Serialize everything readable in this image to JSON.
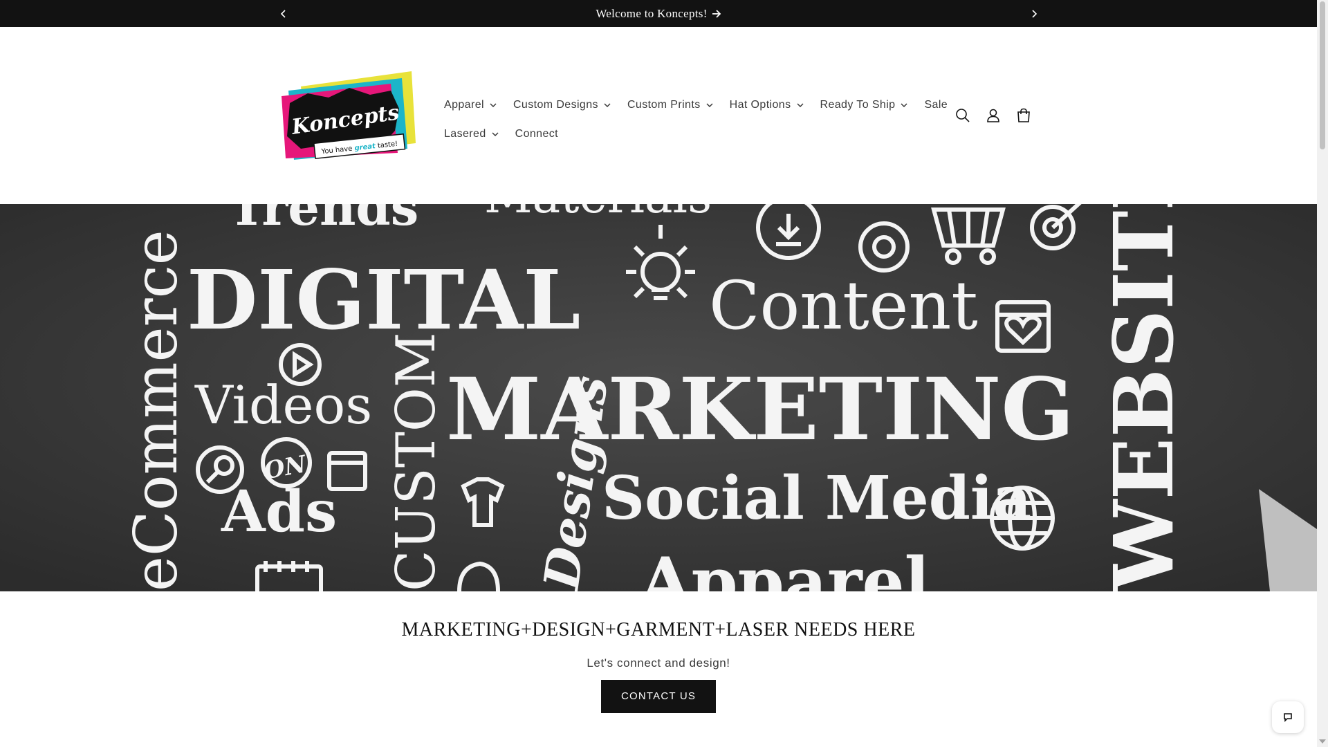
{
  "announcement": {
    "text": "Welcome to Koncepts!"
  },
  "logo": {
    "brand": "Koncepts",
    "tagline_pre": "You have ",
    "tagline_em": "great",
    "tagline_post": " taste!"
  },
  "nav": {
    "items": [
      {
        "label": "Apparel",
        "dropdown": true
      },
      {
        "label": "Custom Designs",
        "dropdown": true
      },
      {
        "label": "Custom Prints",
        "dropdown": true
      },
      {
        "label": "Hat Options",
        "dropdown": true
      },
      {
        "label": "Ready To Ship",
        "dropdown": true
      },
      {
        "label": "Sale",
        "dropdown": false
      },
      {
        "label": "Lasered",
        "dropdown": true
      },
      {
        "label": "Connect",
        "dropdown": false
      }
    ]
  },
  "header_icons": [
    "search-icon",
    "account-icon",
    "cart-icon"
  ],
  "hero": {
    "words": {
      "trends": "Trends",
      "materials": "Materials",
      "digital": "DIGITAL",
      "content": "Content",
      "videos": "Videos",
      "marketing": "MARKETING",
      "ads": "Ads",
      "social_media": "Social Media",
      "apparel": "Apparel",
      "ecommerce": "eCommerce",
      "custom": "CUSTOM",
      "designs": "Designs",
      "website": "WEBSITE",
      "on": "ON"
    }
  },
  "content": {
    "heading": "MARKETING+DESIGN+GARMENT+LASER NEEDS HERE",
    "subtext": "Let's connect and design!",
    "cta_label": "CONTACT US"
  },
  "colors": {
    "dark": "#121212",
    "hero_bg": "#3b3b3b",
    "logo_pink": "#e6177a",
    "logo_cyan": "#1cb5c9",
    "logo_yellow": "#e8e23a"
  }
}
